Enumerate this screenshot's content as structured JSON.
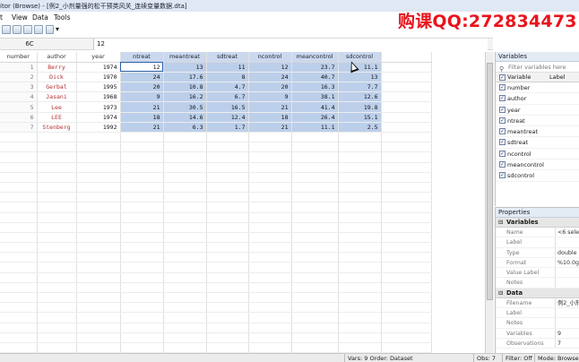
{
  "window": {
    "title": "itor (Browse) - [例2_小剂量强的松干预类风关_连续变量数据.dta]",
    "promo": "购课QQ:272834473"
  },
  "menu": [
    "t",
    "View",
    "Data",
    "Tools"
  ],
  "editbar": {
    "cell_ref": "6C",
    "cell_value": "12"
  },
  "table": {
    "headers": [
      "number",
      "author",
      "year",
      "ntreat",
      "meantreat",
      "sdtreat",
      "ncontrol",
      "meancontrol",
      "sdcontrol"
    ],
    "rows": [
      [
        "1",
        "Berry",
        "1974",
        "12",
        "13",
        "11",
        "12",
        "23.7",
        "11.1"
      ],
      [
        "2",
        "Dick",
        "1970",
        "24",
        "17.6",
        "8",
        "24",
        "40.7",
        "13"
      ],
      [
        "3",
        "Gerbal",
        "1995",
        "20",
        "10.8",
        "4.7",
        "20",
        "16.3",
        "7.7"
      ],
      [
        "4",
        "Jasani",
        "1968",
        "9",
        "16.2",
        "6.7",
        "9",
        "38.1",
        "12.6"
      ],
      [
        "5",
        "Lee",
        "1973",
        "21",
        "30.5",
        "16.5",
        "21",
        "41.4",
        "19.8"
      ],
      [
        "6",
        "LEE",
        "1974",
        "18",
        "14.6",
        "12.4",
        "18",
        "26.4",
        "15.1"
      ],
      [
        "7",
        "Stenberg",
        "1992",
        "21",
        "6.3",
        "1.7",
        "21",
        "11.1",
        "2.5"
      ]
    ]
  },
  "variables": {
    "title": "Variables",
    "filter_placeholder": "Filter variables here",
    "col_variable": "Variable",
    "col_label": "Label",
    "items": [
      "number",
      "author",
      "year",
      "ntreat",
      "meantreat",
      "sdtreat",
      "ncontrol",
      "meancontrol",
      "sdcontrol"
    ]
  },
  "properties": {
    "title": "Properties",
    "sections": [
      {
        "name": "Variables",
        "rows": [
          {
            "key": "Name",
            "value": "<6 sele"
          },
          {
            "key": "Label",
            "value": ""
          },
          {
            "key": "Type",
            "value": "double"
          },
          {
            "key": "Format",
            "value": "%10.0g"
          },
          {
            "key": "Value Label",
            "value": ""
          },
          {
            "key": "Notes",
            "value": ""
          }
        ]
      },
      {
        "name": "Data",
        "rows": [
          {
            "key": "Filename",
            "value": "例2_小剂"
          },
          {
            "key": "Label",
            "value": ""
          },
          {
            "key": "Notes",
            "value": ""
          },
          {
            "key": "Variables",
            "value": "9"
          },
          {
            "key": "Observations",
            "value": "7"
          }
        ]
      }
    ]
  },
  "status": {
    "vars": "Vars: 9  Order: Dataset",
    "obs": "Obs: 7",
    "filter": "Filter: Off",
    "mode": "Mode: Browse"
  }
}
